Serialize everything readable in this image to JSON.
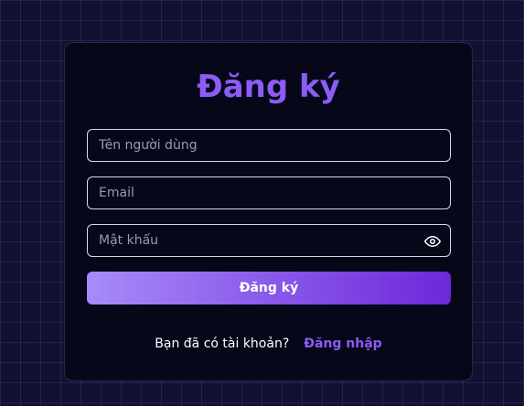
{
  "form": {
    "title": "Đăng ký",
    "username_placeholder": "Tên người dùng",
    "email_placeholder": "Email",
    "password_placeholder": "Mật khẩu",
    "submit_label": "Đăng ký",
    "password_toggle_icon": "eye-icon"
  },
  "footer": {
    "question": "Bạn đã có tài khoản?",
    "login_link": "Đăng nhập"
  },
  "colors": {
    "accent": "#8b5cf6",
    "button_gradient_start": "#a78bfa",
    "button_gradient_end": "#6d28d9",
    "background": "#111133",
    "card": "#07071a"
  }
}
